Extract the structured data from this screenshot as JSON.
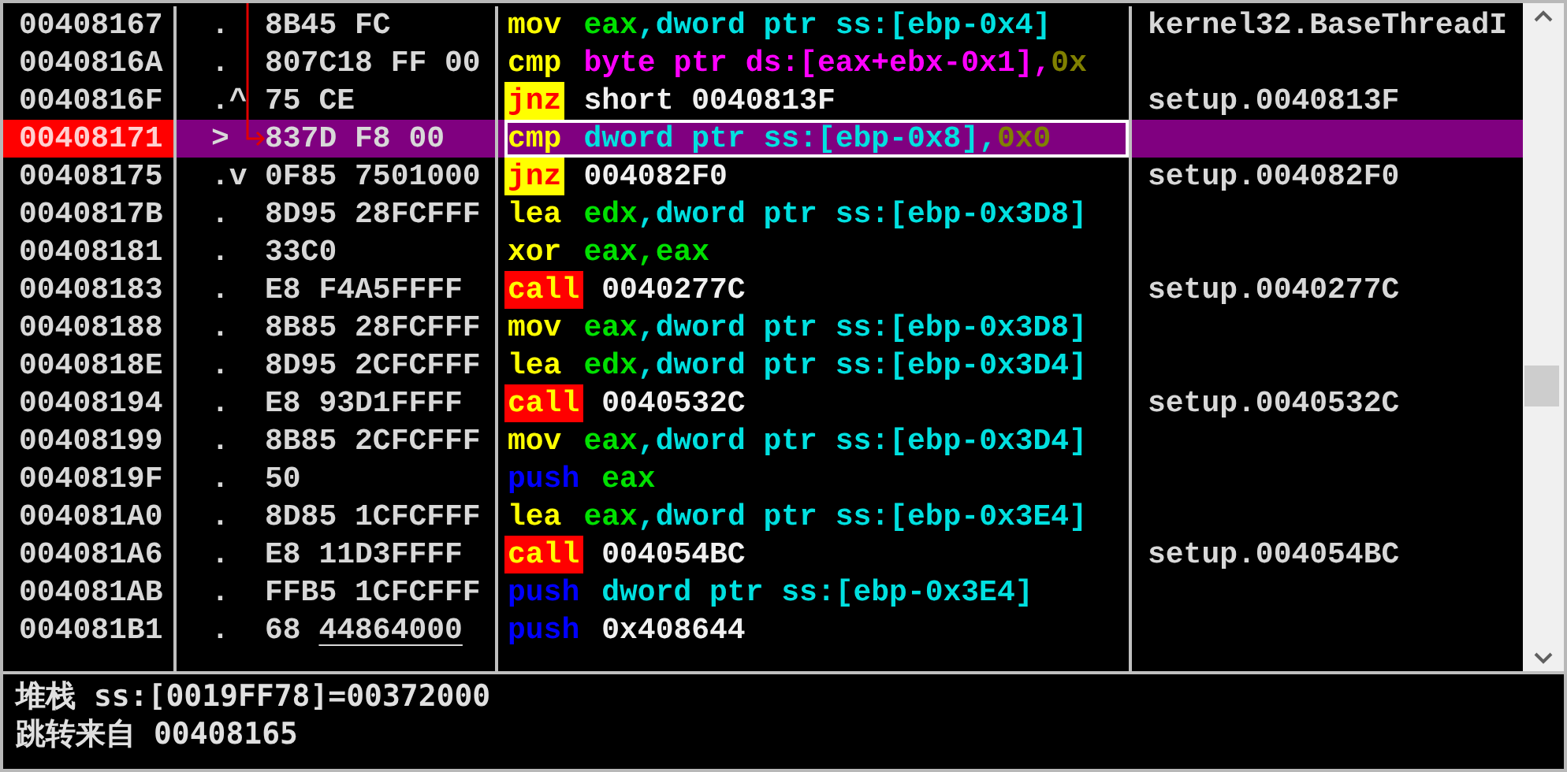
{
  "rows": [
    {
      "address": "00408167",
      "marker": ".",
      "hex": "8B45 FC",
      "mnemonic": {
        "text": "mov",
        "kind": "plain"
      },
      "operands": [
        {
          "text": "eax",
          "kind": "reg"
        },
        {
          "text": ",dword ptr ss:[ebp-0x4]",
          "kind": "mem"
        }
      ],
      "comment": "kernel32.BaseThreadI",
      "selected": false,
      "underlined": false
    },
    {
      "address": "0040816A",
      "marker": ".",
      "hex": "807C18 FF 00",
      "mnemonic": {
        "text": "cmp",
        "kind": "plain"
      },
      "operands": [
        {
          "text": "byte ptr ds:[eax+ebx-0x1],",
          "kind": "bmem"
        },
        {
          "text": "0x",
          "kind": "const"
        }
      ],
      "selected": false,
      "underlined": false
    },
    {
      "address": "0040816F",
      "marker": ".^",
      "hex": "75 CE",
      "mnemonic": {
        "text": "jnz",
        "kind": "jump"
      },
      "operands": [
        {
          "text": "short 0040813F",
          "kind": "addr"
        }
      ],
      "comment": "setup.0040813F",
      "selected": false,
      "underlined": false
    },
    {
      "address": "00408171",
      "marker": ">",
      "hex": "837D F8 00",
      "mnemonic": {
        "text": "cmp",
        "kind": "plain"
      },
      "operands": [
        {
          "text": "dword ptr ss:[ebp-0x8],",
          "kind": "mem"
        },
        {
          "text": "0x0",
          "kind": "const"
        }
      ],
      "selected": true,
      "underlined": false
    },
    {
      "address": "00408175",
      "marker": ".v",
      "hex": "0F85 7501000",
      "mnemonic": {
        "text": "jnz",
        "kind": "jump"
      },
      "operands": [
        {
          "text": "004082F0",
          "kind": "addr"
        }
      ],
      "comment": "setup.004082F0",
      "selected": false,
      "underlined": false
    },
    {
      "address": "0040817B",
      "marker": ".",
      "hex": "8D95 28FCFFF",
      "mnemonic": {
        "text": "lea",
        "kind": "plain"
      },
      "operands": [
        {
          "text": "edx",
          "kind": "reg"
        },
        {
          "text": ",dword ptr ss:[ebp-0x3D8]",
          "kind": "mem"
        }
      ],
      "selected": false,
      "underlined": false
    },
    {
      "address": "00408181",
      "marker": ".",
      "hex": "33C0",
      "mnemonic": {
        "text": "xor",
        "kind": "plain"
      },
      "operands": [
        {
          "text": "eax,eax",
          "kind": "reg"
        }
      ],
      "selected": false,
      "underlined": false
    },
    {
      "address": "00408183",
      "marker": ".",
      "hex": "E8 F4A5FFFF",
      "mnemonic": {
        "text": "call",
        "kind": "call"
      },
      "operands": [
        {
          "text": "0040277C",
          "kind": "addr"
        }
      ],
      "comment": "setup.0040277C",
      "selected": false,
      "underlined": false
    },
    {
      "address": "00408188",
      "marker": ".",
      "hex": "8B85 28FCFFF",
      "mnemonic": {
        "text": "mov",
        "kind": "plain"
      },
      "operands": [
        {
          "text": "eax",
          "kind": "reg"
        },
        {
          "text": ",dword ptr ss:[ebp-0x3D8]",
          "kind": "mem"
        }
      ],
      "selected": false,
      "underlined": false
    },
    {
      "address": "0040818E",
      "marker": ".",
      "hex": "8D95 2CFCFFF",
      "mnemonic": {
        "text": "lea",
        "kind": "plain"
      },
      "operands": [
        {
          "text": "edx",
          "kind": "reg"
        },
        {
          "text": ",dword ptr ss:[ebp-0x3D4]",
          "kind": "mem"
        }
      ],
      "selected": false,
      "underlined": false
    },
    {
      "address": "00408194",
      "marker": ".",
      "hex": "E8 93D1FFFF",
      "mnemonic": {
        "text": "call",
        "kind": "call"
      },
      "operands": [
        {
          "text": "0040532C",
          "kind": "addr"
        }
      ],
      "comment": "setup.0040532C",
      "selected": false,
      "underlined": false
    },
    {
      "address": "00408199",
      "marker": ".",
      "hex": "8B85 2CFCFFF",
      "mnemonic": {
        "text": "mov",
        "kind": "plain"
      },
      "operands": [
        {
          "text": "eax",
          "kind": "reg"
        },
        {
          "text": ",dword ptr ss:[ebp-0x3D4]",
          "kind": "mem"
        }
      ],
      "selected": false,
      "underlined": false
    },
    {
      "address": "0040819F",
      "marker": ".",
      "hex": "50",
      "mnemonic": {
        "text": "push",
        "kind": "push"
      },
      "operands": [
        {
          "text": "eax",
          "kind": "reg"
        }
      ],
      "selected": false,
      "underlined": false
    },
    {
      "address": "004081A0",
      "marker": ".",
      "hex": "8D85 1CFCFFF",
      "mnemonic": {
        "text": "lea",
        "kind": "plain"
      },
      "operands": [
        {
          "text": "eax",
          "kind": "reg"
        },
        {
          "text": ",dword ptr ss:[ebp-0x3E4]",
          "kind": "mem"
        }
      ],
      "selected": false,
      "underlined": false
    },
    {
      "address": "004081A6",
      "marker": ".",
      "hex": "E8 11D3FFFF",
      "mnemonic": {
        "text": "call",
        "kind": "call"
      },
      "operands": [
        {
          "text": "004054BC",
          "kind": "addr"
        }
      ],
      "comment": "setup.004054BC",
      "selected": false,
      "underlined": false
    },
    {
      "address": "004081AB",
      "marker": ".",
      "hex": "FFB5 1CFCFFF",
      "mnemonic": {
        "text": "push",
        "kind": "push"
      },
      "operands": [
        {
          "text": "dword ptr ss:[ebp-0x3E4]",
          "kind": "mem"
        }
      ],
      "selected": false,
      "underlined": false
    },
    {
      "address": "004081B1",
      "marker": ".",
      "hex": "68 44864000",
      "mnemonic": {
        "text": "push",
        "kind": "push"
      },
      "operands": [
        {
          "text": "0x408644",
          "kind": "addr"
        }
      ],
      "selected": false,
      "underlined": true
    }
  ],
  "info_pane": [
    "堆栈 ss:[0019FF78]=00372000",
    "跳转来自 00408165"
  ]
}
